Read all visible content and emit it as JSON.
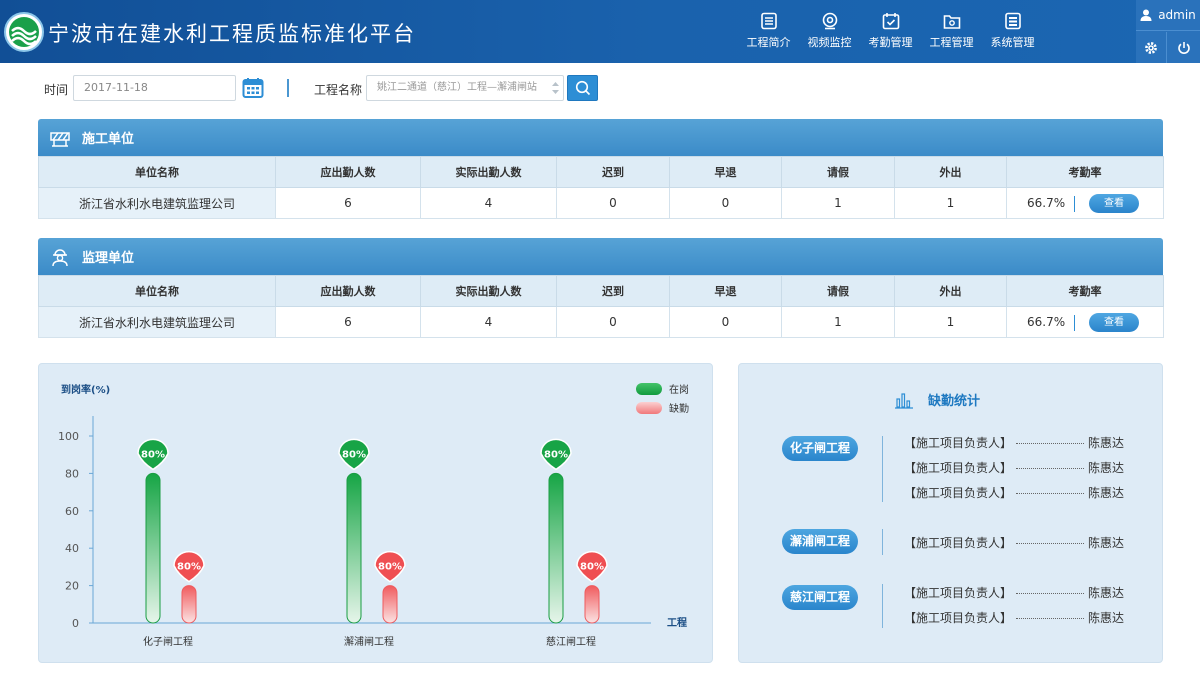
{
  "header": {
    "title": "宁波市在建水利工程质监标准化平台",
    "nav": [
      {
        "label": "工程简介",
        "icon": "document-icon"
      },
      {
        "label": "视频监控",
        "icon": "camera-icon"
      },
      {
        "label": "考勤管理",
        "icon": "calendar-check-icon"
      },
      {
        "label": "工程管理",
        "icon": "folder-gear-icon"
      },
      {
        "label": "系统管理",
        "icon": "list-icon"
      }
    ],
    "user": "admin"
  },
  "filters": {
    "time_label": "时间",
    "date_value": "2017-11-18",
    "project_label": "工程名称",
    "project_value": "姚江二通道（慈江）工程—澥浦闸站"
  },
  "construction": {
    "title": "施工单位",
    "columns": [
      "单位名称",
      "应出勤人数",
      "实际出勤人数",
      "迟到",
      "早退",
      "请假",
      "外出",
      "考勤率"
    ],
    "row": {
      "name": "浙江省水利水电建筑监理公司",
      "expected": "6",
      "actual": "4",
      "late": "0",
      "early": "0",
      "leave": "1",
      "out": "1",
      "rate": "66.7%"
    },
    "view_label": "查看"
  },
  "supervision": {
    "title": "监理单位",
    "columns": [
      "单位名称",
      "应出勤人数",
      "实际出勤人数",
      "迟到",
      "早退",
      "请假",
      "外出",
      "考勤率"
    ],
    "row": {
      "name": "浙江省水利水电建筑监理公司",
      "expected": "6",
      "actual": "4",
      "late": "0",
      "early": "0",
      "leave": "1",
      "out": "1",
      "rate": "66.7%"
    },
    "view_label": "查看"
  },
  "chart_data": {
    "type": "bar",
    "ylabel": "到岗率(%)",
    "xlabel": "工程",
    "ylim": [
      0,
      100
    ],
    "yticks": [
      0,
      20,
      40,
      60,
      80,
      100
    ],
    "categories": [
      "化子闸工程",
      "澥浦闸工程",
      "慈江闸工程"
    ],
    "series": [
      {
        "name": "在岗",
        "values": [
          80,
          80,
          80
        ],
        "labels": [
          "80%",
          "80%",
          "80%"
        ],
        "color": "#1fae4a"
      },
      {
        "name": "缺勤",
        "values": [
          20,
          20,
          20
        ],
        "labels": [
          "80%",
          "80%",
          "80%"
        ],
        "color": "#f0595c"
      }
    ],
    "legend": "top-right"
  },
  "absence": {
    "title": "缺勤统计",
    "groups": [
      {
        "project": "化子闸工程",
        "items": [
          {
            "role": "【施工项目负责人】",
            "name": "陈惠达"
          },
          {
            "role": "【施工项目负责人】",
            "name": "陈惠达"
          },
          {
            "role": "【施工项目负责人】",
            "name": "陈惠达"
          }
        ]
      },
      {
        "project": "澥浦闸工程",
        "items": [
          {
            "role": "【施工项目负责人】",
            "name": "陈惠达"
          }
        ]
      },
      {
        "project": "慈江闸工程",
        "items": [
          {
            "role": "【施工项目负责人】",
            "name": "陈惠达"
          },
          {
            "role": "【施工项目负责人】",
            "name": "陈惠达"
          }
        ]
      }
    ]
  }
}
